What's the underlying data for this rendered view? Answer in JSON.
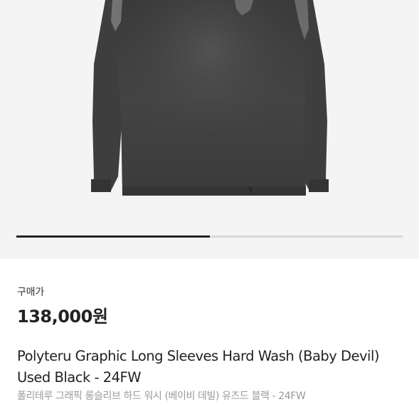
{
  "gallery": {
    "image": "black-long-sleeve-graphic-tee",
    "progress": 0.5
  },
  "product": {
    "price_label": "구매가",
    "price": "138,000원",
    "name_en": "Polyteru Graphic Long Sleeves Hard Wash (Baby Devil) Used Black - 24FW",
    "name_ko": "폴리테루 그래픽 롱슬리브 하드 워시 (베이비 데빌) 유즈드 블랙 - 24FW"
  },
  "colors": {
    "background": "#ffffff",
    "gallery_bg": "#f4f4f4",
    "progress_fill": "#222222",
    "progress_track": "#d9d9d9",
    "subtitle": "#9a9a9a"
  }
}
